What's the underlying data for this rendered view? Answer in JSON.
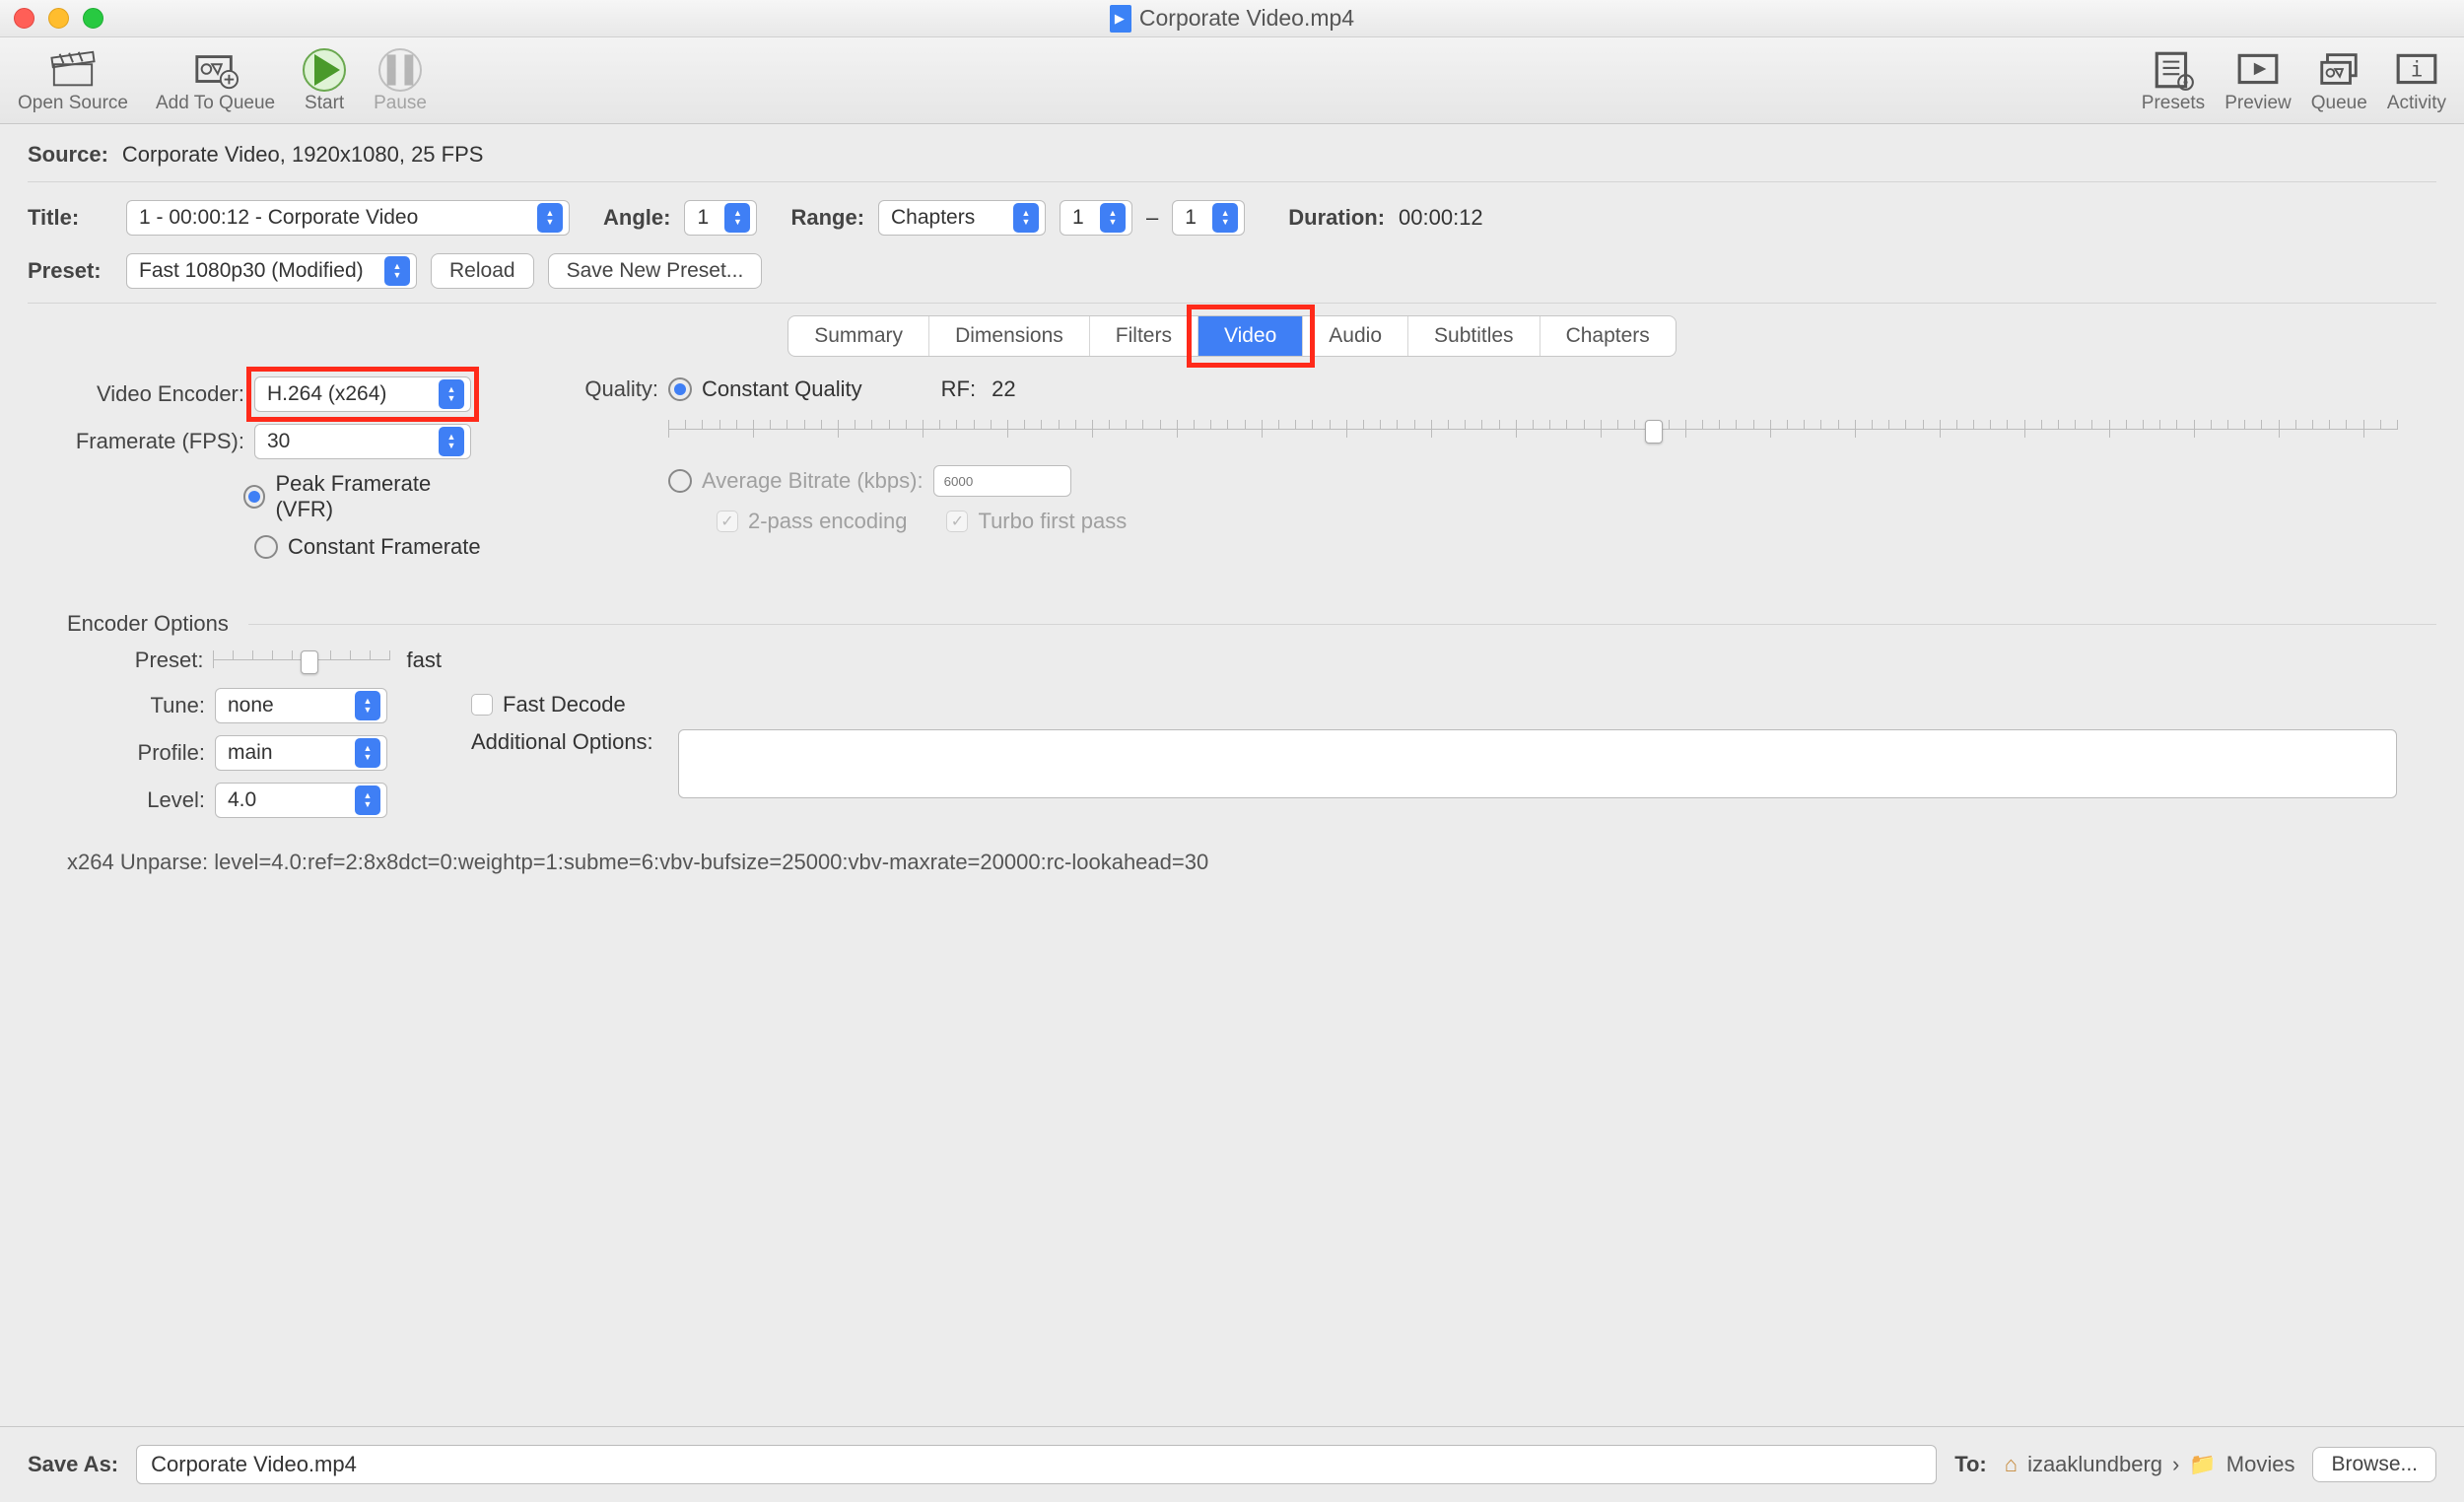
{
  "window": {
    "title": "Corporate Video.mp4"
  },
  "toolbar": {
    "open_source": "Open Source",
    "add_to_queue": "Add To Queue",
    "start": "Start",
    "pause": "Pause",
    "presets": "Presets",
    "preview": "Preview",
    "queue": "Queue",
    "activity": "Activity"
  },
  "source": {
    "label": "Source:",
    "value": "Corporate Video, 1920x1080, 25 FPS"
  },
  "title_row": {
    "label": "Title:",
    "value": "1 - 00:00:12 - Corporate Video",
    "angle_label": "Angle:",
    "angle_value": "1",
    "range_label": "Range:",
    "range_type": "Chapters",
    "range_from": "1",
    "range_dash": "–",
    "range_to": "1",
    "duration_label": "Duration:",
    "duration_value": "00:00:12"
  },
  "preset_row": {
    "label": "Preset:",
    "value": "Fast 1080p30 (Modified)",
    "reload": "Reload",
    "save_new": "Save New Preset..."
  },
  "tabs": [
    "Summary",
    "Dimensions",
    "Filters",
    "Video",
    "Audio",
    "Subtitles",
    "Chapters"
  ],
  "active_tab": "Video",
  "video_panel": {
    "encoder_label": "Video Encoder:",
    "encoder_value": "H.264 (x264)",
    "framerate_label": "Framerate (FPS):",
    "framerate_value": "30",
    "peak_vfr": "Peak Framerate (VFR)",
    "constant_fr": "Constant Framerate",
    "quality_label": "Quality:",
    "cq_label": "Constant Quality",
    "rf_label": "RF:",
    "rf_value": "22",
    "avg_bitrate_label": "Average Bitrate (kbps):",
    "avg_bitrate_placeholder": "6000",
    "twopass": "2-pass encoding",
    "turbo": "Turbo first pass"
  },
  "encoder_options": {
    "header": "Encoder Options",
    "preset_label": "Preset:",
    "preset_speed": "fast",
    "tune_label": "Tune:",
    "tune_value": "none",
    "fast_decode": "Fast Decode",
    "profile_label": "Profile:",
    "profile_value": "main",
    "additional_label": "Additional Options:",
    "level_label": "Level:",
    "level_value": "4.0"
  },
  "unparse_line": "x264 Unparse: level=4.0:ref=2:8x8dct=0:weightp=1:subme=6:vbv-bufsize=25000:vbv-maxrate=20000:rc-lookahead=30",
  "footer": {
    "save_as_label": "Save As:",
    "save_as_value": "Corporate Video.mp4",
    "to_label": "To:",
    "path_user": "izaaklundberg",
    "path_sep": "›",
    "path_folder": "Movies",
    "browse": "Browse..."
  }
}
